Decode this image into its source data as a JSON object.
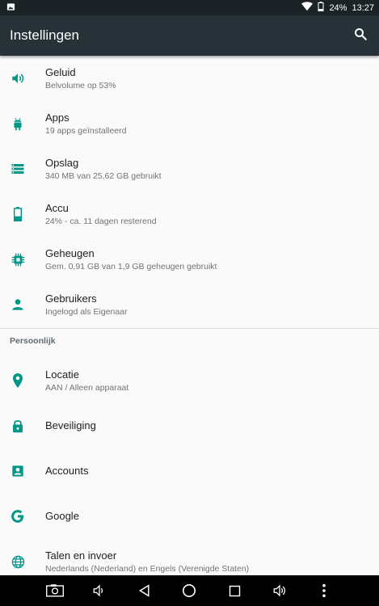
{
  "status_bar": {
    "battery_percent": "24%",
    "time": "13:27",
    "icons": [
      "image-notification-icon",
      "wifi-icon",
      "battery-icon"
    ]
  },
  "toolbar": {
    "title": "Instellingen",
    "search_icon": "search-icon"
  },
  "accent_color": "#009688",
  "device_items": [
    {
      "title": "Geluid",
      "subtitle": "Belvolume op 53%",
      "icon": "volume-icon"
    },
    {
      "title": "Apps",
      "subtitle": "19 apps geïnstalleerd",
      "icon": "android-icon"
    },
    {
      "title": "Opslag",
      "subtitle": "340 MB van 25,62 GB gebruikt",
      "icon": "storage-icon"
    },
    {
      "title": "Accu",
      "subtitle": "24% - ca. 11 dagen resterend",
      "icon": "battery-icon"
    },
    {
      "title": "Geheugen",
      "subtitle": "Gem. 0,91 GB van 1,9 GB geheugen gebruikt",
      "icon": "memory-icon"
    },
    {
      "title": "Gebruikers",
      "subtitle": "Ingelogd als Eigenaar",
      "icon": "person-icon"
    }
  ],
  "section_personal": "Persoonlijk",
  "personal_items": [
    {
      "title": "Locatie",
      "subtitle": "AAN / Alleen apparaat",
      "icon": "location-icon"
    },
    {
      "title": "Beveiliging",
      "subtitle": "",
      "icon": "lock-icon"
    },
    {
      "title": "Accounts",
      "subtitle": "",
      "icon": "account-icon"
    },
    {
      "title": "Google",
      "subtitle": "",
      "icon": "google-icon"
    },
    {
      "title": "Talen en invoer",
      "subtitle": "Nederlands (Nederland) en Engels (Verenigde Staten)",
      "icon": "globe-icon"
    }
  ],
  "nav_bar": [
    "screenshot-icon",
    "volume-down-icon",
    "back-icon",
    "home-icon",
    "recents-icon",
    "volume-up-icon",
    "more-icon"
  ]
}
